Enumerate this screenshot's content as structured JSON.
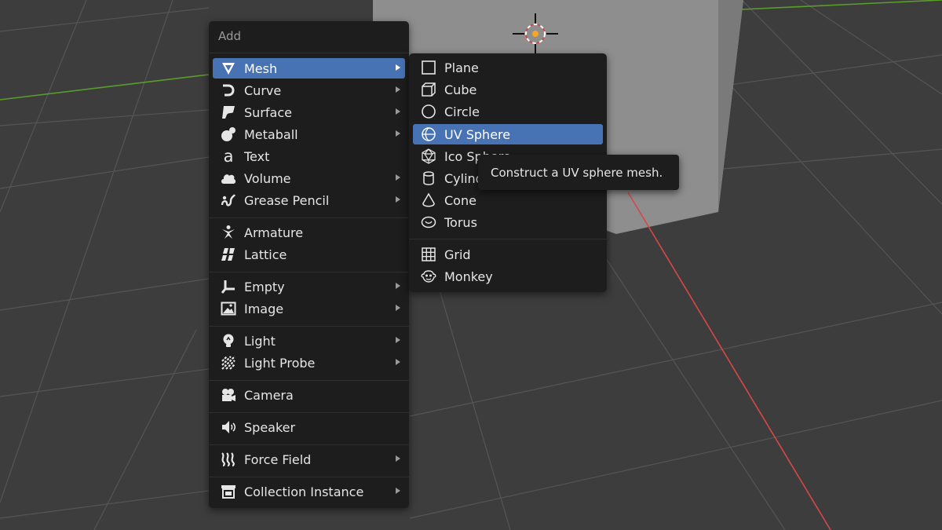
{
  "add_menu": {
    "title": "Add",
    "items": [
      {
        "label": "Mesh",
        "icon": "mesh-icon",
        "submenu": true,
        "active": true
      },
      {
        "label": "Curve",
        "icon": "curve-icon",
        "submenu": true
      },
      {
        "label": "Surface",
        "icon": "surface-icon",
        "submenu": true
      },
      {
        "label": "Metaball",
        "icon": "metaball-icon",
        "submenu": true
      },
      {
        "label": "Text",
        "icon": "text-icon",
        "submenu": false
      },
      {
        "label": "Volume",
        "icon": "volume-icon",
        "submenu": true
      },
      {
        "label": "Grease Pencil",
        "icon": "grease-pencil-icon",
        "submenu": true
      },
      {
        "label": "Armature",
        "icon": "armature-icon",
        "submenu": false
      },
      {
        "label": "Lattice",
        "icon": "lattice-icon",
        "submenu": false
      },
      {
        "label": "Empty",
        "icon": "empty-icon",
        "submenu": true
      },
      {
        "label": "Image",
        "icon": "image-icon",
        "submenu": true
      },
      {
        "label": "Light",
        "icon": "light-icon",
        "submenu": true
      },
      {
        "label": "Light Probe",
        "icon": "light-probe-icon",
        "submenu": true
      },
      {
        "label": "Camera",
        "icon": "camera-icon",
        "submenu": false
      },
      {
        "label": "Speaker",
        "icon": "speaker-icon",
        "submenu": false
      },
      {
        "label": "Force Field",
        "icon": "force-field-icon",
        "submenu": true
      },
      {
        "label": "Collection Instance",
        "icon": "collection-instance-icon",
        "submenu": true
      }
    ]
  },
  "mesh_menu": {
    "items": [
      {
        "label": "Plane",
        "icon": "plane-icon"
      },
      {
        "label": "Cube",
        "icon": "cube-icon"
      },
      {
        "label": "Circle",
        "icon": "circle-icon"
      },
      {
        "label": "UV Sphere",
        "icon": "uv-sphere-icon",
        "active": true
      },
      {
        "label": "Ico Sphere",
        "icon": "ico-sphere-icon"
      },
      {
        "label": "Cylinder",
        "icon": "cylinder-icon"
      },
      {
        "label": "Cone",
        "icon": "cone-icon"
      },
      {
        "label": "Torus",
        "icon": "torus-icon"
      },
      {
        "label": "Grid",
        "icon": "grid-icon"
      },
      {
        "label": "Monkey",
        "icon": "monkey-icon"
      }
    ]
  },
  "tooltip": {
    "text": "Construct a UV sphere mesh."
  },
  "colors": {
    "accent": "#4772b3",
    "menu_bg": "#1d1d1d",
    "viewport_bg": "#3d3d3d",
    "x_axis": "#d64848",
    "y_axis": "#5a9e2a"
  }
}
